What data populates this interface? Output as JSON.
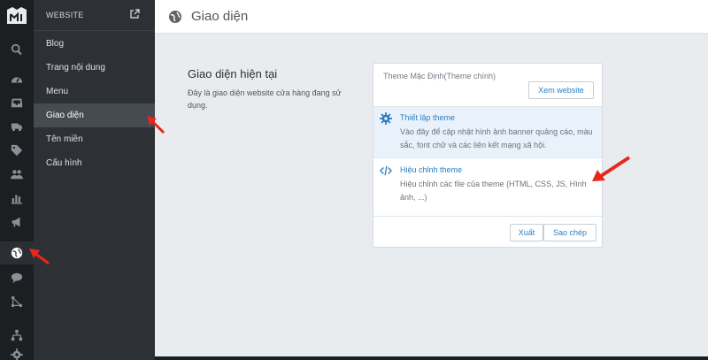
{
  "rail": {
    "items": [
      {
        "icon": "search-icon"
      },
      {
        "icon": "dashboard-icon"
      },
      {
        "icon": "inbox-icon"
      },
      {
        "icon": "truck-icon"
      },
      {
        "icon": "tag-icon"
      },
      {
        "icon": "users-icon"
      },
      {
        "icon": "bar-chart-icon"
      },
      {
        "icon": "megaphone-icon"
      },
      {
        "icon": "globe-icon",
        "active": true
      },
      {
        "icon": "chat-icon"
      },
      {
        "icon": "share-nodes-icon"
      },
      {
        "icon": "sitemap-icon"
      },
      {
        "icon": "gear-icon"
      }
    ]
  },
  "sidebar": {
    "title": "WEBSITE",
    "items": [
      {
        "label": "Blog"
      },
      {
        "label": "Trang nội dung"
      },
      {
        "label": "Menu"
      },
      {
        "label": "Giao diện",
        "active": true
      },
      {
        "label": "Tên miền"
      },
      {
        "label": "Cấu hình"
      }
    ]
  },
  "header": {
    "title": "Giao diện"
  },
  "main": {
    "section_title": "Giao diện hiện tại",
    "section_desc": "Đây là giao diện website cửa hàng đang sử dụng."
  },
  "theme_card": {
    "name": "Theme Mặc Định(Theme chính)",
    "view_button": "Xem website",
    "options": [
      {
        "label": "Thiết lập theme",
        "desc": "Vào đây để cập nhật hình ảnh banner quảng cáo, màu sắc, font chữ và các liên kết mạng xã hội."
      },
      {
        "label": "Hiệu chỉnh theme",
        "desc": "Hiệu chỉnh các file của theme (HTML, CSS, JS, Hình ảnh, ...)"
      }
    ],
    "export_button": "Xuất",
    "copy_button": "Sao chép"
  },
  "colors": {
    "accent": "#2b7fc2",
    "sidebar": "#2d3135",
    "rail": "#1c1f22",
    "annotation": "#e8261c"
  }
}
